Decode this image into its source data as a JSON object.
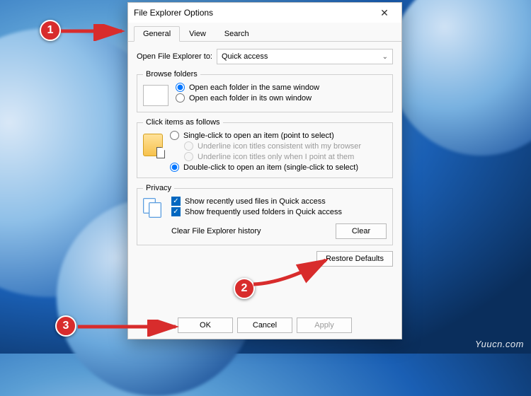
{
  "window": {
    "title": "File Explorer Options",
    "close_icon": "✕"
  },
  "tabs": {
    "general": "General",
    "view": "View",
    "search": "Search"
  },
  "open_to": {
    "label": "Open File Explorer to:",
    "value": "Quick access"
  },
  "browse_group": {
    "legend": "Browse folders",
    "same_window": "Open each folder in the same window",
    "own_window": "Open each folder in its own window"
  },
  "click_group": {
    "legend": "Click items as follows",
    "single": "Single-click to open an item (point to select)",
    "underline_browser": "Underline icon titles consistent with my browser",
    "underline_point": "Underline icon titles only when I point at them",
    "double": "Double-click to open an item (single-click to select)"
  },
  "privacy_group": {
    "legend": "Privacy",
    "recent_files": "Show recently used files in Quick access",
    "frequent_folders": "Show frequently used folders in Quick access",
    "clear_label": "Clear File Explorer history",
    "clear_button": "Clear"
  },
  "restore_button": "Restore Defaults",
  "footer": {
    "ok": "OK",
    "cancel": "Cancel",
    "apply": "Apply"
  },
  "annotations": {
    "badge1": "1",
    "badge2": "2",
    "badge3": "3"
  },
  "watermark": "Yuucn.com"
}
